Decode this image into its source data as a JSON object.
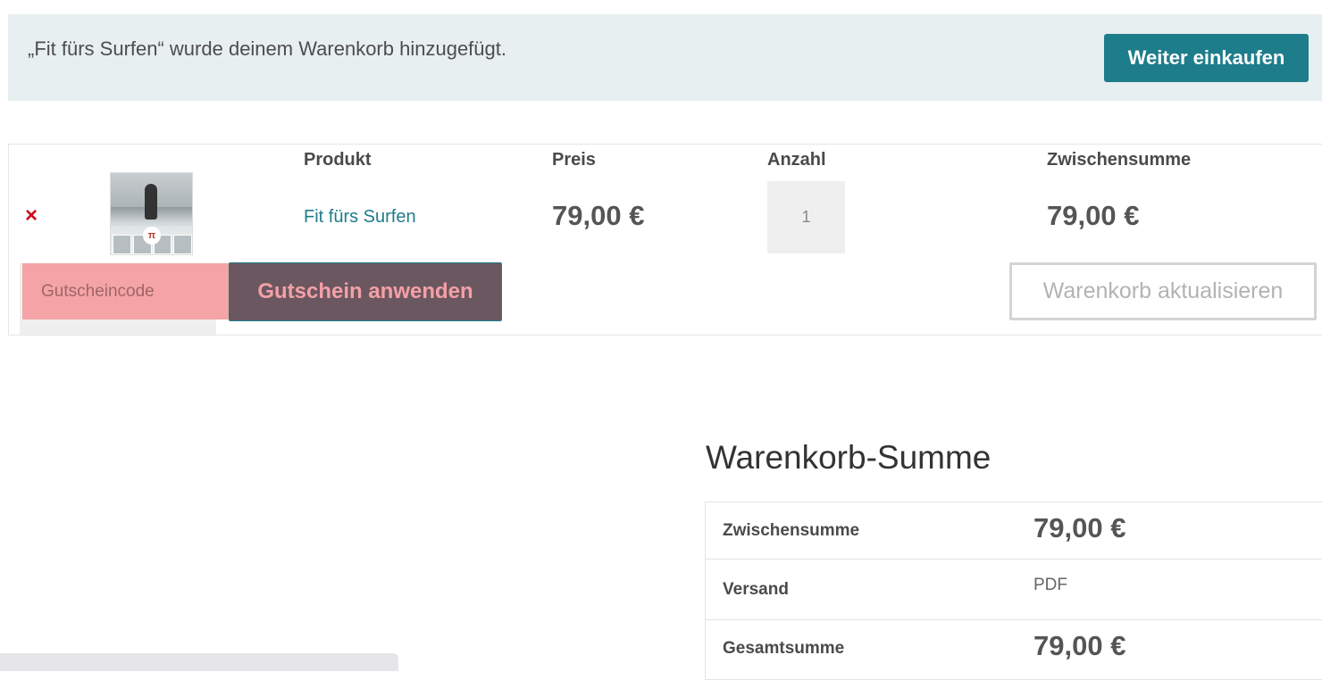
{
  "notice": {
    "message": "„Fit fürs Surfen“ wurde deinem Warenkorb hinzugefügt.",
    "continue_label": "Weiter einkaufen"
  },
  "cart": {
    "headers": [
      "Produkt",
      "Preis",
      "Anzahl",
      "Zwischensumme"
    ],
    "remove_symbol": "×",
    "item": {
      "name": "Fit fürs Surfen",
      "price": "79,00 €",
      "quantity": "1",
      "subtotal": "79,00 €"
    },
    "coupon_placeholder": "Gutscheincode",
    "apply_label": "Gutschein anwenden",
    "update_label": "Warenkorb aktualisieren"
  },
  "totals": {
    "title": "Warenkorb-Summe",
    "rows": [
      {
        "label": "Zwischensumme",
        "value": "79,00 €"
      },
      {
        "label": "Versand",
        "value": "PDF"
      },
      {
        "label": "Gesamtsumme",
        "value": "79,00 €"
      }
    ]
  },
  "colors": {
    "accent": "#1e7d8a",
    "remove": "#d0021b",
    "notice_bg": "#e8eff1"
  }
}
